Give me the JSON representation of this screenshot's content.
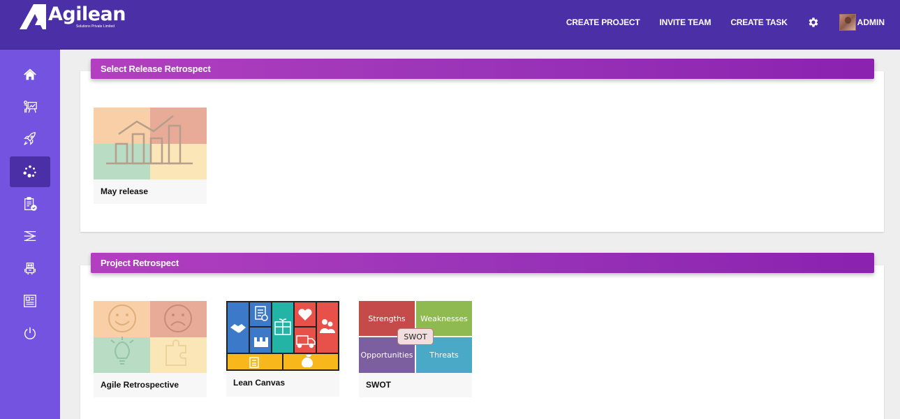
{
  "header": {
    "logo_name": "Agilean",
    "logo_subtitle": "Solutions Private Limited",
    "nav": [
      {
        "label": "CREATE PROJECT"
      },
      {
        "label": "INVITE TEAM"
      },
      {
        "label": "CREATE TASK"
      }
    ],
    "user_label": "ADMIN"
  },
  "sidebar": {
    "items": [
      {
        "icon": "home-icon"
      },
      {
        "icon": "presenter-board-icon"
      },
      {
        "icon": "rocket-icon"
      },
      {
        "icon": "retrospect-dots-icon",
        "active": true
      },
      {
        "icon": "clipboard-check-icon"
      },
      {
        "icon": "flow-icon"
      },
      {
        "icon": "robot-icon"
      },
      {
        "icon": "newspaper-icon"
      },
      {
        "icon": "power-icon"
      }
    ]
  },
  "release_section": {
    "title": "Select Release Retrospect",
    "cards": [
      {
        "label": "May release"
      }
    ]
  },
  "project_section": {
    "title": "Project Retrospect",
    "cards": [
      {
        "label": "Agile Retrospective"
      },
      {
        "label": "Lean Canvas"
      },
      {
        "label": "SWOT"
      }
    ],
    "swot": {
      "strengths": "Strengths",
      "weaknesses": "Weaknesses",
      "opportunities": "Opportunities",
      "threats": "Threats",
      "center": "SWOT"
    }
  },
  "colors": {
    "header_bg": "#4a2fa6",
    "sidebar_bg": "#7353e0",
    "section_header": "#9a34b8"
  }
}
